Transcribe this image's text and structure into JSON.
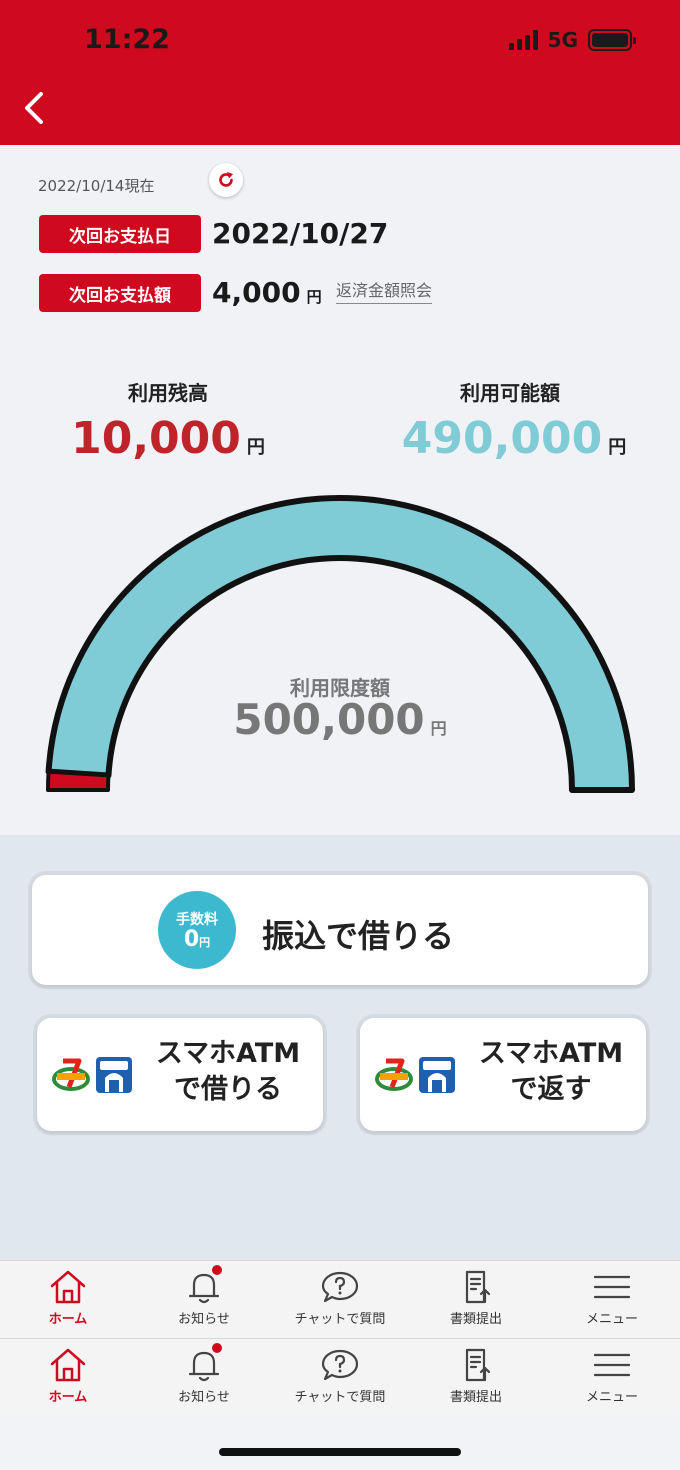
{
  "status_bar": {
    "time": "11:22",
    "network": "5G"
  },
  "header": {
    "back_icon": "chevron-left-icon"
  },
  "summary": {
    "as_of": "2022/10/14現在",
    "next_payment_date_label": "次回お支払日",
    "next_payment_date": "2022/10/27",
    "next_payment_amount_label": "次回お支払額",
    "next_payment_amount": "4,000",
    "yen": "円",
    "repayment_link": "返済金額照会"
  },
  "usage": {
    "used_label": "利用残高",
    "used_value": "10,000",
    "available_label": "利用可能額",
    "available_value": "490,000",
    "limit_label": "利用限度額",
    "limit_value": "500,000",
    "used_fraction": 0.02
  },
  "actions": {
    "transfer_fee_label": "手数料",
    "transfer_fee_value": "0",
    "transfer_label": "振込で借りる",
    "atm_borrow_line1": "スマホATM",
    "atm_borrow_line2": "で借りる",
    "atm_repay_line1": "スマホATM",
    "atm_repay_line2": "で返す"
  },
  "tabbar": {
    "home": "ホーム",
    "notices": "お知らせ",
    "chat": "チャットで質問",
    "documents": "書類提出",
    "menu": "メニュー"
  },
  "colors": {
    "brand_red": "#cf0a1e",
    "available_teal": "#7fcbd6",
    "fee_badge": "#3db9cf"
  }
}
